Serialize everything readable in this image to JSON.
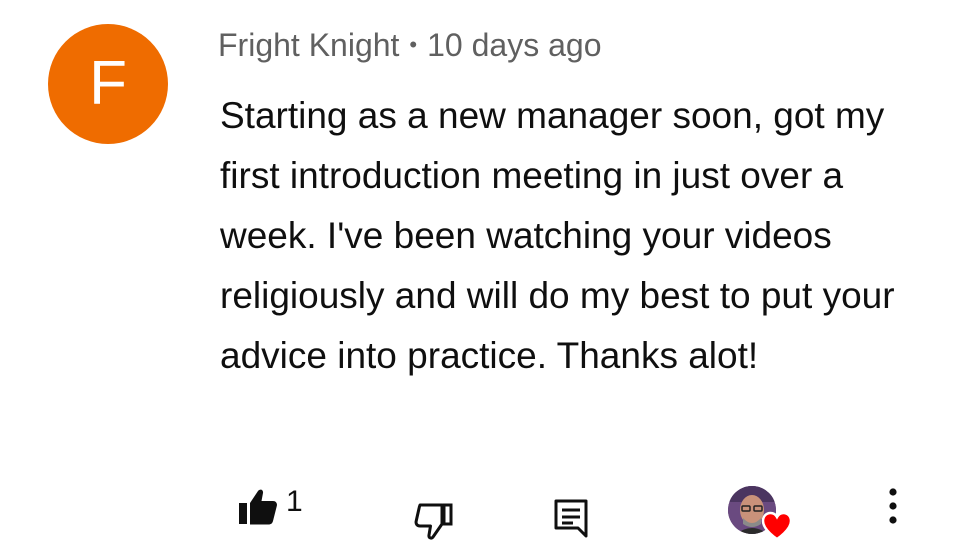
{
  "comment": {
    "avatar_letter": "F",
    "author": "Fright Knight",
    "separator": "•",
    "timestamp": "10 days ago",
    "text": "Starting as a new manager soon, got my first introduction meeting in just over a week. I've been watching your videos religiously and will do my best to put your advice into practice. Thanks alot!",
    "avatar_color": "#ef6c00"
  },
  "actions": {
    "like_count": "1",
    "like_icon": "thumbs-up-filled-icon",
    "dislike_icon": "thumbs-down-icon",
    "reply_icon": "comment-reply-icon",
    "creator_heart_icon": "creator-heart-icon",
    "more_icon": "vertical-dots-icon",
    "heart_color": "#ff0000"
  }
}
